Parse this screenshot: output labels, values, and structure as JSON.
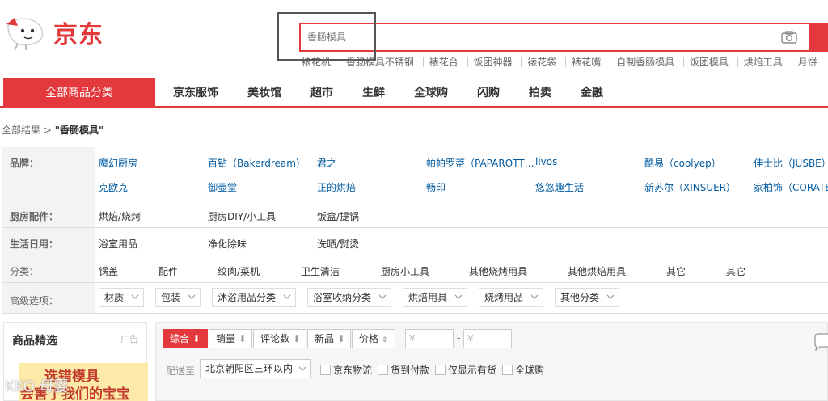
{
  "header": {
    "logo_text": "京东",
    "search_placeholder": "香肠模具",
    "hotwords": [
      "裱花机",
      "香肠模具不锈钢",
      "裱花台",
      "饭团神器",
      "裱花袋",
      "裱花嘴",
      "自制香肠模具",
      "饭团模具",
      "烘焙工具",
      "月饼"
    ]
  },
  "nav": {
    "all_categories": "全部商品分类",
    "items": [
      "京东服饰",
      "美妆馆",
      "超市",
      "生鲜",
      "全球购",
      "闪购",
      "拍卖",
      "金融"
    ]
  },
  "breadcrumb": {
    "all": "全部结果",
    "sep": ">",
    "keyword": "\"香肠模具\""
  },
  "filters": {
    "brand": {
      "label": "品牌：",
      "row1": [
        "魔幻厨房",
        "百钻（Bakerdream）",
        "君之",
        "帕帕罗蒂（PAPAROTT…",
        "livos",
        "酷易（coolyep）",
        "佳士比（JUSBE）"
      ],
      "row2": [
        "克欧克",
        "御壶堂",
        "正的烘焙",
        "畅印",
        "悠悠趣生活",
        "新苏尔（XINSUER）",
        "家柏饰（CORATE"
      ]
    },
    "kitchen": {
      "label": "厨房配件：",
      "items": [
        "烘焙/烧烤",
        "厨房DIY/小工具",
        "饭盒/提锅"
      ]
    },
    "daily": {
      "label": "生活日用：",
      "items": [
        "浴室用品",
        "净化除味",
        "洗晒/熨烫"
      ]
    },
    "category": {
      "label": "分类：",
      "items": [
        "锅盖",
        "配件",
        "绞肉/菜机",
        "卫生清洁",
        "厨房小工具",
        "其他烧烤用具",
        "其他烘焙用具",
        "其它",
        "其它"
      ]
    },
    "advanced": {
      "label": "高级选项：",
      "items": [
        "材质",
        "包装",
        "沐浴用品分类",
        "浴室收纳分类",
        "烘焙用具",
        "烧烤用品",
        "其他分类"
      ]
    }
  },
  "ad": {
    "title": "商品精选",
    "tag": "广告",
    "line1": "选错模具",
    "line2": "会害了我们的宝宝"
  },
  "sort": {
    "buttons": [
      "综合",
      "销量",
      "评论数",
      "新品",
      "价格"
    ],
    "price_min": "¥",
    "price_max": "¥",
    "price_sep": "-",
    "ship_label": "配送至",
    "ship_location": "北京朝阳区三环以内",
    "checkboxes": [
      "京东物流",
      "货到付款",
      "仅显示有货",
      "全球购"
    ]
  },
  "watermark": "KKO 母婴",
  "colors": {
    "brand_red": "#e4393c",
    "link_blue": "#005aa0"
  }
}
